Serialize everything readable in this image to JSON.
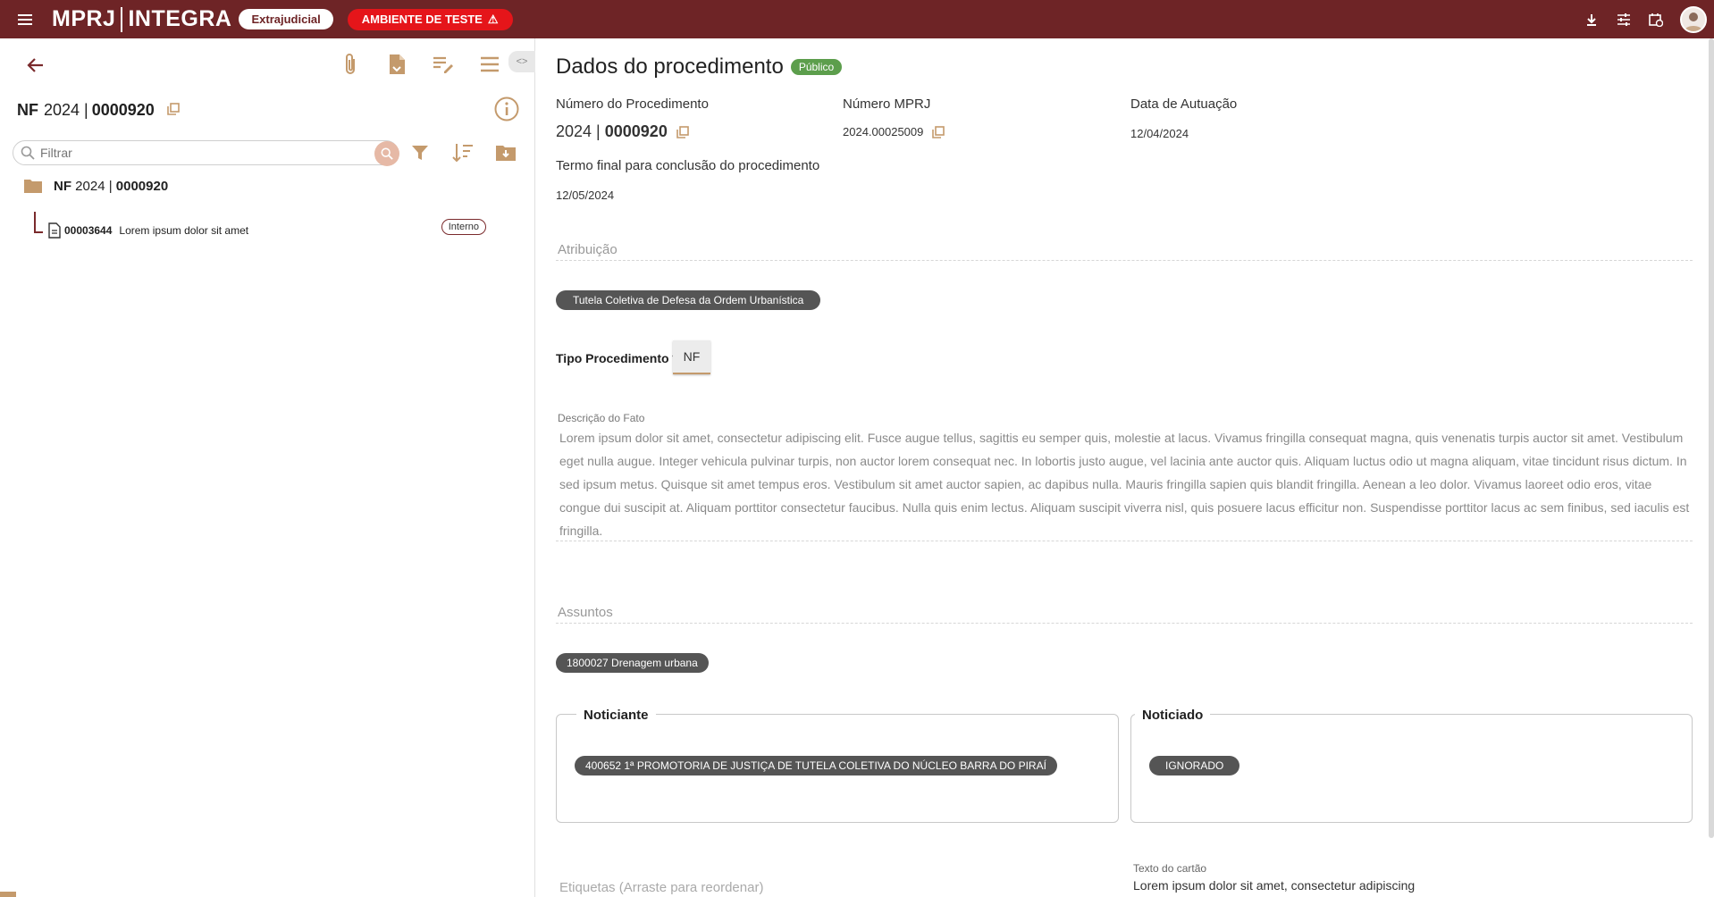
{
  "topbar": {
    "brand_left": "MPRJ",
    "brand_right": "INTEGRA",
    "module_pill": "Extrajudicial",
    "env_pill": "AMBIENTE DE TESTE",
    "env_warning": "⚠"
  },
  "left": {
    "proc_type": "NF",
    "proc_year": "2024 |",
    "proc_number": "0000920",
    "filter_placeholder": "Filtrar",
    "collapse_label": "<>",
    "tree": {
      "root_type": "NF",
      "root_year": "2024 |",
      "root_number": "0000920",
      "item_number": "00003644",
      "item_title": "Lorem ipsum dolor sit amet",
      "item_chip": "Interno"
    }
  },
  "right": {
    "title": "Dados do procedimento",
    "visibility_badge": "Público",
    "numero_procedimento_label": "Número do Procedimento",
    "numero_procedimento_year": "2024 |",
    "numero_procedimento_value": "0000920",
    "numero_mprj_label": "Número MPRJ",
    "numero_mprj_value": "2024.00025009",
    "data_autuacao_label": "Data de Autuação",
    "data_autuacao_value": "12/04/2024",
    "termo_final_label": "Termo final para conclusão do procedimento",
    "termo_final_value": "12/05/2024",
    "atribuicao_label": "Atribuição",
    "atribuicao_chip": "Tutela Coletiva de Defesa da Ordem Urbanística",
    "tipo_label": "Tipo Procedimento *",
    "tipo_value": "NF",
    "descricao_label": "Descrição do Fato",
    "descricao_text": "Lorem ipsum dolor sit amet, consectetur adipiscing elit. Fusce augue tellus, sagittis eu semper quis, molestie at lacus. Vivamus fringilla consequat magna, quis venenatis turpis auctor sit amet. Vestibulum eget nulla augue. Integer vehicula pulvinar turpis, non auctor lorem consequat nec. In lobortis justo augue, vel lacinia ante auctor quis. Aliquam luctus odio ut magna aliquam, vitae tincidunt risus dictum. In sed ipsum metus. Quisque sit amet tempus eros. Vestibulum sit amet auctor sapien, ac dapibus nulla. Mauris fringilla sapien quis blandit fringilla. Aenean a leo dolor. Vivamus laoreet odio eros, vitae congue dui suscipit at. Aliquam porttitor consectetur faucibus. Nulla quis enim lectus. Aliquam suscipit viverra nisl, quis posuere lacus efficitur non. Suspendisse porttitor lacus ac sem finibus, sed iaculis est fringilla.",
    "assuntos_label": "Assuntos",
    "assunto_chip": "1800027  Drenagem urbana",
    "noticiante_label": "Noticiante",
    "noticiante_chip": "400652  1ª PROMOTORIA DE JUSTIÇA DE TUTELA COLETIVA DO NÚCLEO BARRA DO PIRAÍ",
    "noticiado_label": "Noticiado",
    "noticiado_chip": "IGNORADO",
    "etiquetas_label": "Etiquetas (Arraste para reordenar)",
    "texto_cartao_label": "Texto do cartão",
    "texto_cartao_value": "Lorem ipsum dolor sit amet, consectetur adipiscing"
  },
  "icons": {
    "menu": "menu-icon",
    "download": "download-icon",
    "settings": "tune-icon",
    "calendar": "calendar-clock-icon",
    "back": "arrow-left-icon",
    "attach": "paperclip-icon",
    "doc": "file-icon",
    "edit": "edit-note-icon",
    "list": "menu-lines-icon",
    "info": "info-icon",
    "copy": "copy-icon",
    "search": "search-icon",
    "filter": "filter-icon",
    "sort": "sort-icon",
    "folder-download": "folder-download-icon",
    "folder": "folder-icon"
  },
  "colors": {
    "topbar": "#6e2426",
    "accent": "#c49a6c",
    "env_red": "#e5151a",
    "public_green": "#5c9e4c",
    "chip_dark": "#555555"
  }
}
